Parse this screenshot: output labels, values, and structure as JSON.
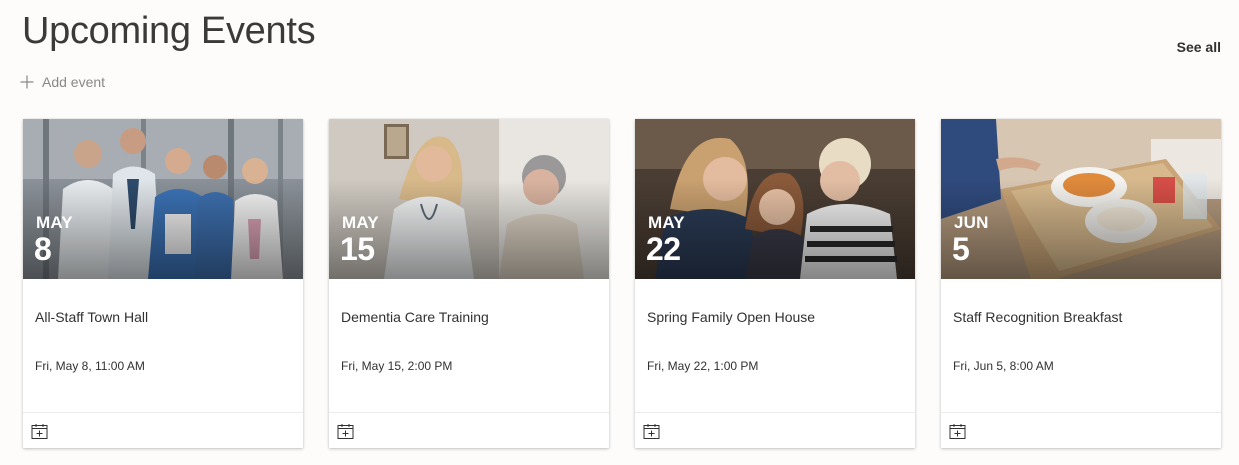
{
  "header": {
    "title": "Upcoming Events",
    "see_all_label": "See all",
    "add_event_label": "Add event"
  },
  "events": [
    {
      "month": "MAY",
      "day": "8",
      "title": "All-Staff Town Hall",
      "datetime": "Fri, May 8, 11:00 AM"
    },
    {
      "month": "MAY",
      "day": "15",
      "title": "Dementia Care Training",
      "datetime": "Fri, May 15, 2:00 PM"
    },
    {
      "month": "MAY",
      "day": "22",
      "title": "Spring Family Open House",
      "datetime": "Fri, May 22, 1:00 PM"
    },
    {
      "month": "JUN",
      "day": "5",
      "title": "Staff Recognition Breakfast",
      "datetime": "Fri, Jun 5, 8:00 AM"
    }
  ],
  "icons": {
    "add": "plus-icon",
    "footer": "add-to-calendar-icon"
  }
}
